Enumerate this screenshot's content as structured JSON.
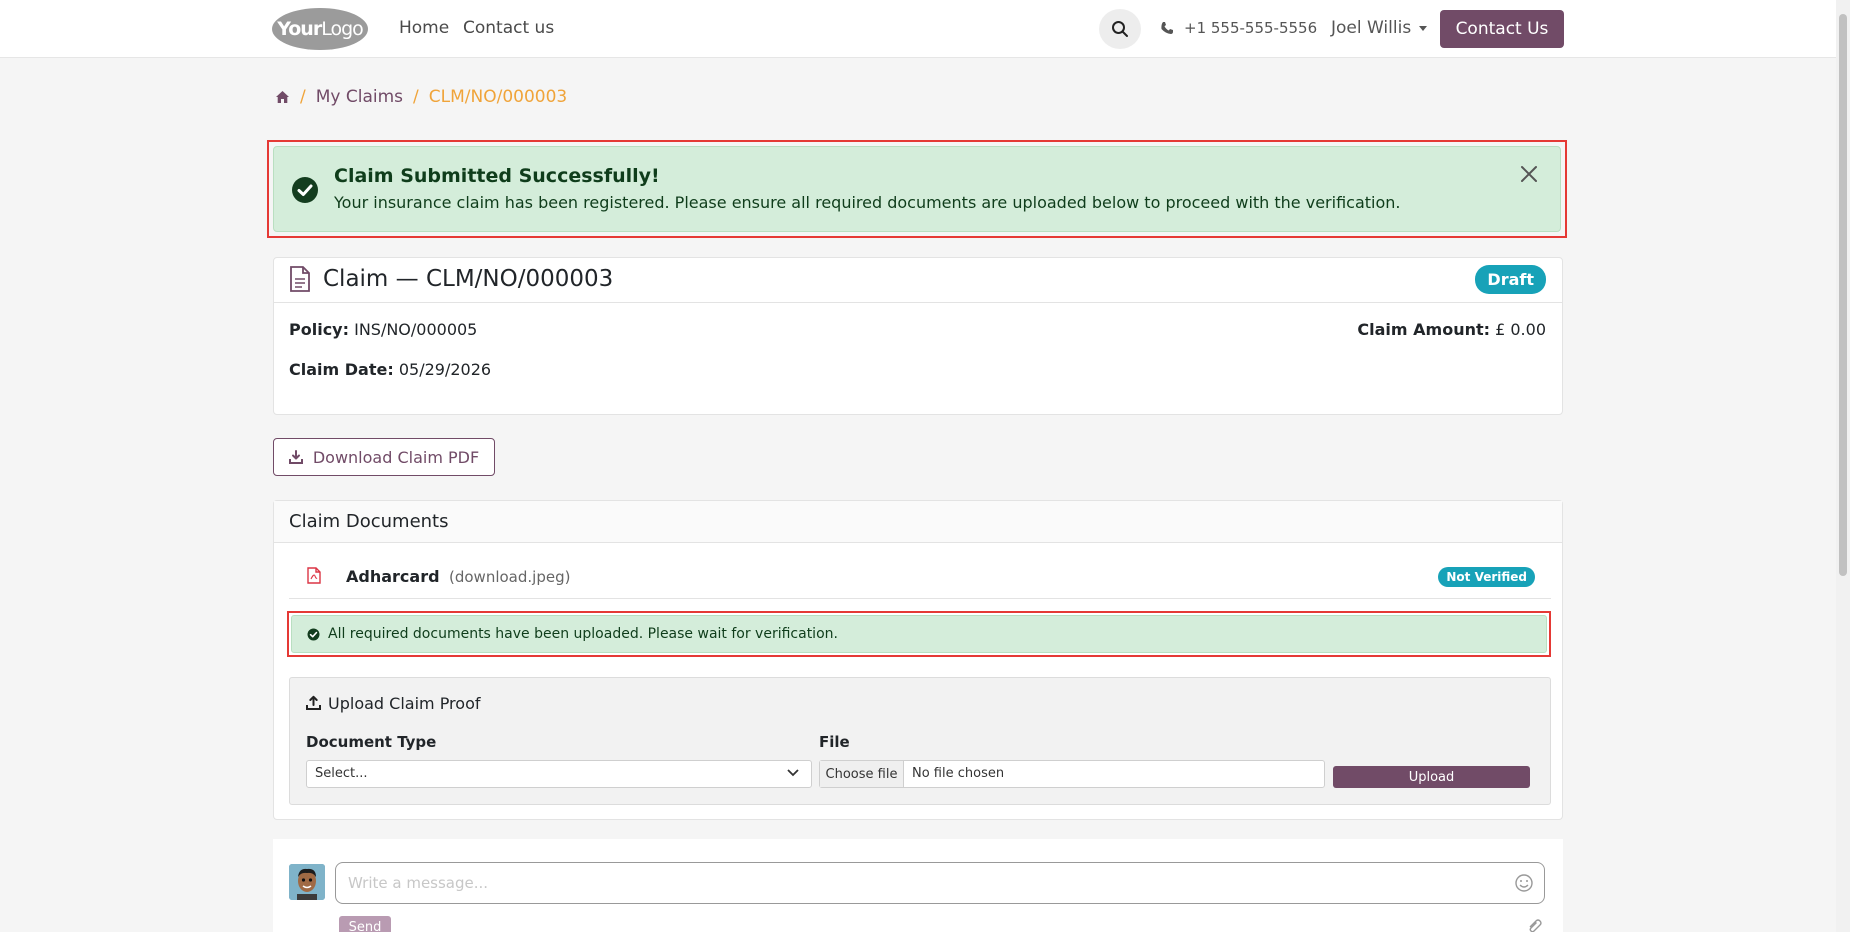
{
  "nav": {
    "logo_bold": "Your",
    "logo_light": "Logo",
    "links": [
      "Home",
      "Contact us"
    ],
    "phone": "+1 555-555-5556",
    "user": "Joel Willis",
    "cta": "Contact Us"
  },
  "breadcrumb": {
    "sep": "/",
    "items": [
      "My Claims",
      "CLM/NO/000003"
    ]
  },
  "alert": {
    "title": "Claim Submitted Successfully!",
    "text": "Your insurance claim has been registered. Please ensure all required documents are uploaded below to proceed with the verification."
  },
  "claim": {
    "title": "Claim — CLM/NO/000003",
    "status": "Draft",
    "policy_label": "Policy:",
    "policy_value": "INS/NO/000005",
    "date_label": "Claim Date:",
    "date_value": "05/29/2026",
    "amount_label": "Claim Amount:",
    "amount_value": "£ 0.00"
  },
  "download_label": "Download Claim PDF",
  "documents": {
    "title": "Claim Documents",
    "items": [
      {
        "name": "Adharcard",
        "file": "(download.jpeg)",
        "status": "Not Verified"
      }
    ],
    "notice": "All required documents have been uploaded. Please wait for verification.",
    "upload": {
      "title": "Upload Claim Proof",
      "type_label": "Document Type",
      "type_value": "Select...",
      "file_label": "File",
      "choose_label": "Choose file",
      "file_status": "No file chosen",
      "button": "Upload"
    }
  },
  "chatter": {
    "placeholder": "Write a message...",
    "send": "Send"
  },
  "colors": {
    "brand": "#714b67",
    "success_bg": "#d4edda",
    "info_badge": "#17a2b8",
    "breadcrumb_active": "#f0a43a"
  }
}
